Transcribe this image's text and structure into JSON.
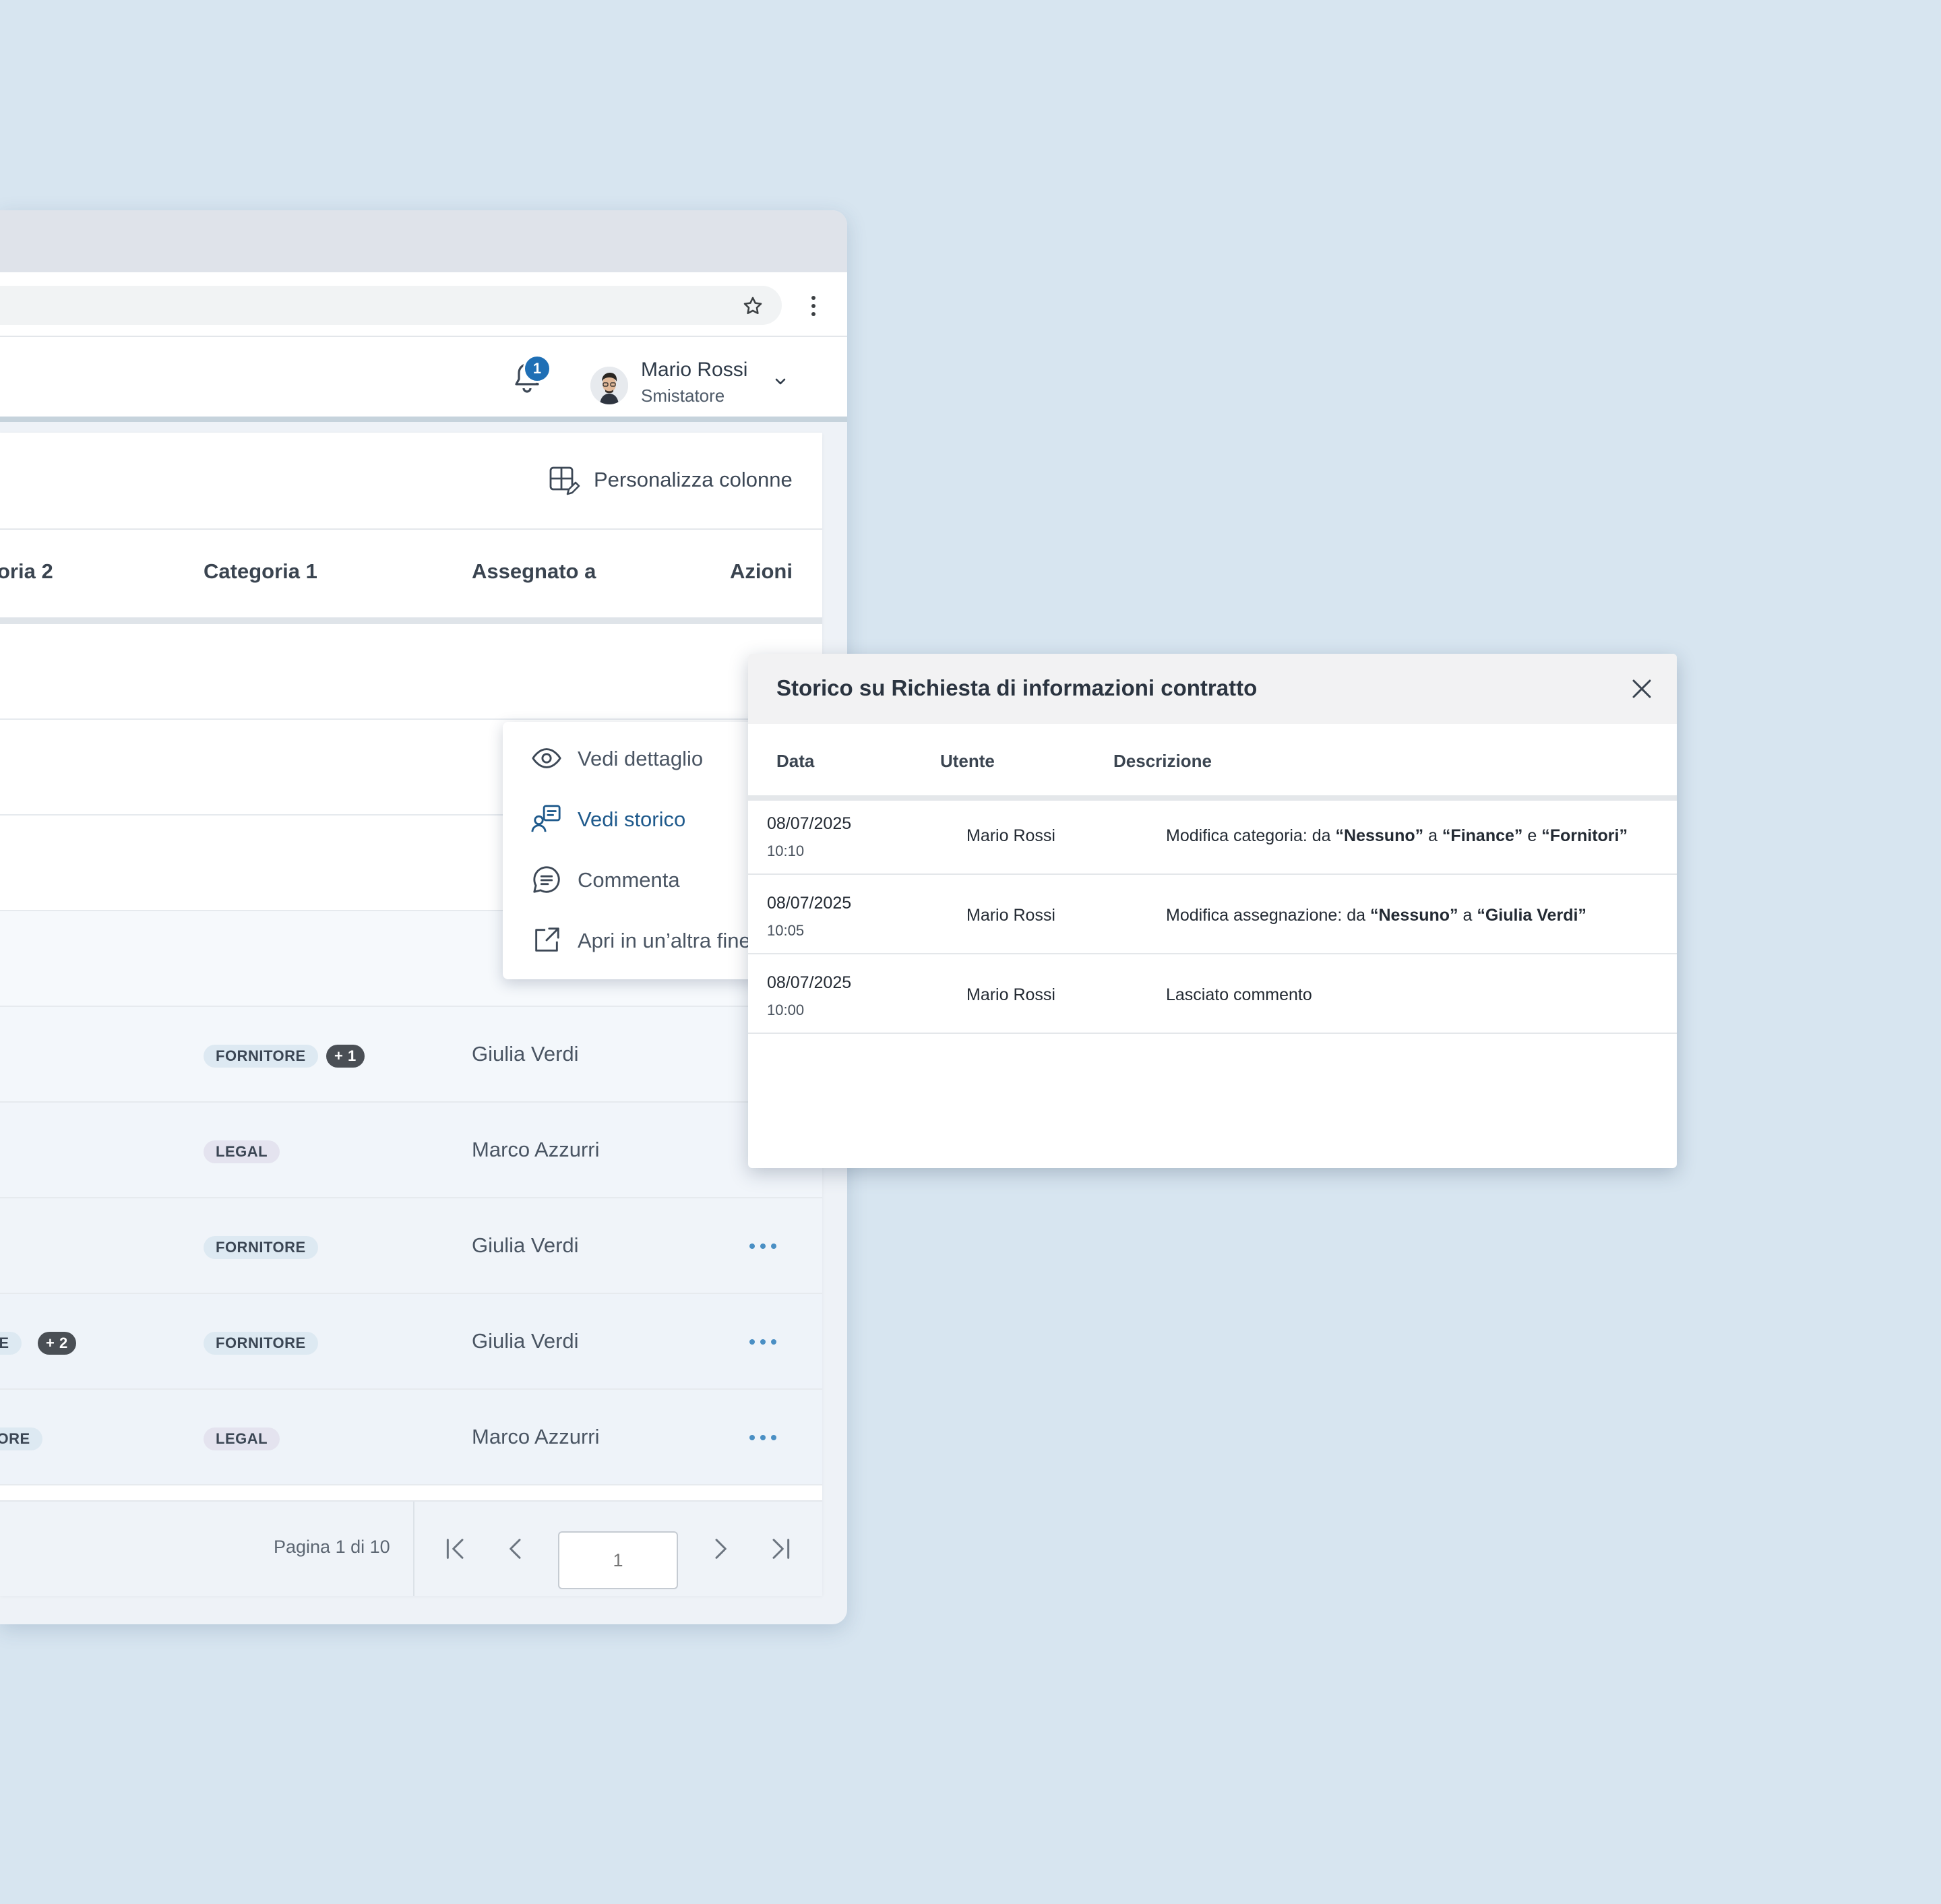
{
  "browser": {
    "star_icon": "star-icon",
    "menu_icon": "kebab-menu-icon"
  },
  "header": {
    "notifications_count": "1",
    "user_name": "Mario Rossi",
    "user_role": "Smistatore"
  },
  "toolbar": {
    "customize_columns_label": "Personalizza colonne"
  },
  "table": {
    "headers": {
      "categoria2": "oria 2",
      "categoria1": "Categoria 1",
      "assegnato": "Assegnato a",
      "azioni": "Azioni"
    },
    "rows": [
      {
        "cat2_tag": "",
        "cat2_more": "",
        "cat1_tag": "FORNITORE",
        "cat1_more": "+ 1",
        "assigned": "Giulia Verdi",
        "has_actions": false
      },
      {
        "cat2_tag": "",
        "cat2_more": "",
        "cat1_tag": "LEGAL",
        "cat1_more": "",
        "assigned": "Marco Azzurri",
        "has_actions": false
      },
      {
        "cat2_tag": "",
        "cat2_more": "",
        "cat1_tag": "FORNITORE",
        "cat1_more": "",
        "assigned": "Giulia Verdi",
        "has_actions": true
      },
      {
        "cat2_tag": "CE",
        "cat2_more": "+ 2",
        "cat1_tag": "FORNITORE",
        "cat1_more": "",
        "assigned": "Giulia Verdi",
        "has_actions": true
      },
      {
        "cat2_tag": "TORE",
        "cat2_more": "",
        "cat1_tag": "LEGAL",
        "cat1_more": "",
        "assigned": "Marco Azzurri",
        "has_actions": true
      }
    ]
  },
  "pagination": {
    "label": "Pagina 1 di 10",
    "page_placeholder": "1"
  },
  "context_menu": {
    "items": [
      {
        "label": "Vedi dettaglio",
        "icon": "eye-icon"
      },
      {
        "label": "Vedi storico",
        "icon": "history-icon"
      },
      {
        "label": "Commenta",
        "icon": "comment-icon"
      },
      {
        "label": "Apri in un’altra fine",
        "icon": "external-link-icon"
      }
    ]
  },
  "history_modal": {
    "title": "Storico su Richiesta di informazioni contratto",
    "headers": {
      "data": "Data",
      "utente": "Utente",
      "descrizione": "Descrizione"
    },
    "rows": [
      {
        "date": "08/07/2025",
        "time": "10:10",
        "user": "Mario Rossi",
        "desc_prefix": "Modifica categoria: da ",
        "desc_b1": "“Nessuno”",
        "desc_mid1": " a ",
        "desc_b2": "“Finance”",
        "desc_mid2": " e ",
        "desc_b3": "“Fornitori”"
      },
      {
        "date": "08/07/2025",
        "time": "10:05",
        "user": "Mario Rossi",
        "desc_prefix": "Modifica assegnazione: da ",
        "desc_b1": "“Nessuno”",
        "desc_mid1": " a ",
        "desc_b2": "“Giulia Verdi”",
        "desc_mid2": "",
        "desc_b3": ""
      },
      {
        "date": "08/07/2025",
        "time": "10:00",
        "user": "Mario Rossi",
        "desc_prefix": "Lasciato commento",
        "desc_b1": "",
        "desc_mid1": "",
        "desc_b2": "",
        "desc_mid2": "",
        "desc_b3": ""
      }
    ]
  },
  "colors": {
    "background": "#d7e5f0",
    "accent": "#1f6fb5",
    "action_dots": "#4a8fc4"
  }
}
